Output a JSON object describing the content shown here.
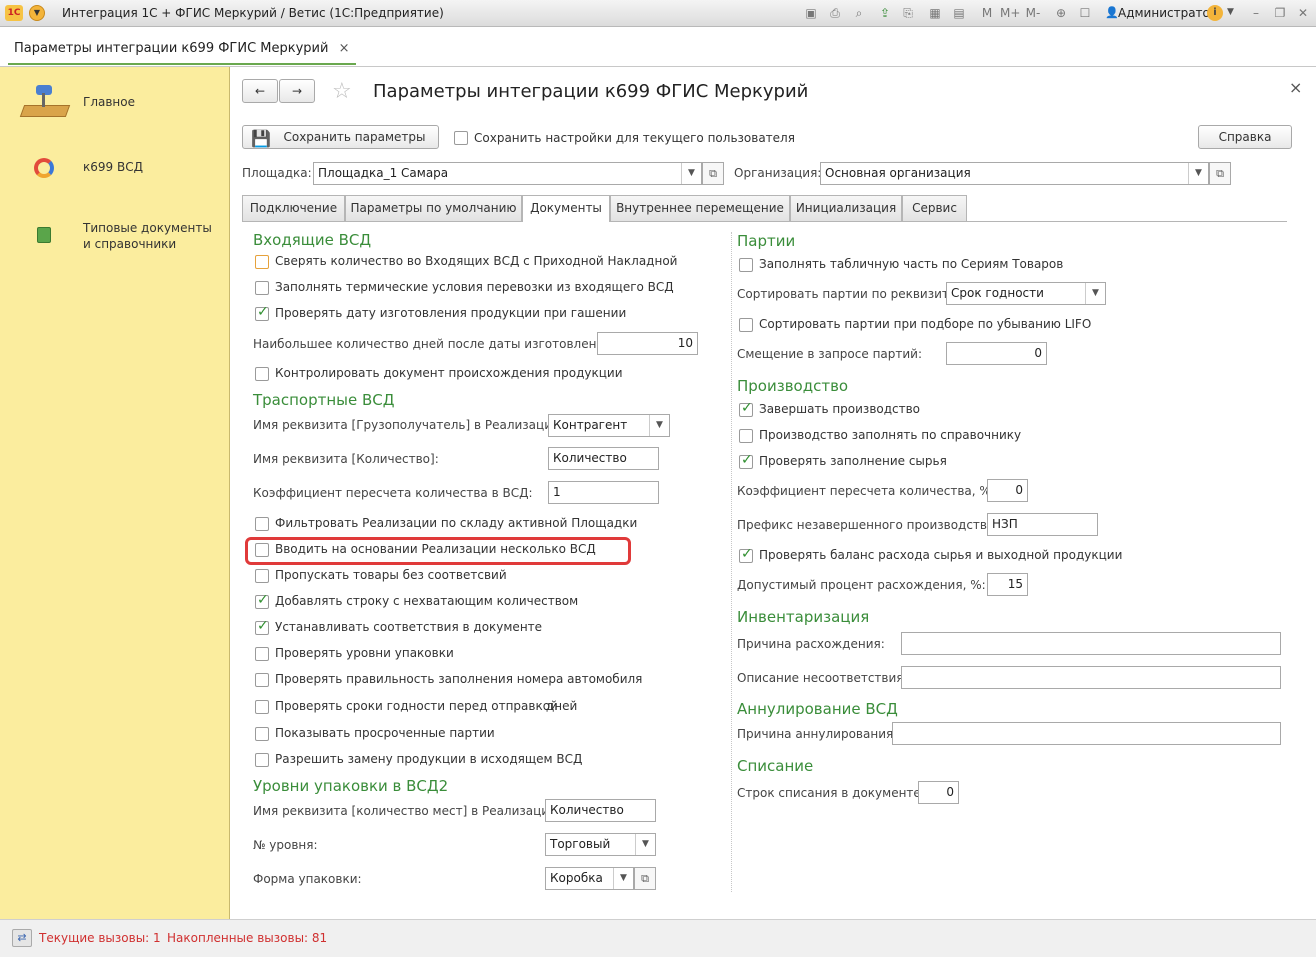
{
  "titlebar": {
    "title": "Интеграция 1С + ФГИС Меркурий / Ветис  (1С:Предприятие)",
    "user": "Администратор",
    "memory_buttons": [
      "M",
      "M+",
      "M-"
    ]
  },
  "doc_tab": {
    "label": "Параметры интеграции к699 ФГИС Меркурий",
    "close": "×"
  },
  "sidebar": {
    "items": [
      {
        "label": "Главное",
        "icon": "desk-lamp-icon"
      },
      {
        "label": "к699 ВСД",
        "icon": "mercury-logo-icon"
      },
      {
        "label": "Типовые документы и справочники",
        "icon": "book-icon"
      }
    ]
  },
  "form": {
    "title": "Параметры интеграции к699 ФГИС Меркурий",
    "close": "×",
    "save_button": "Сохранить параметры",
    "save_user_settings": "Сохранить настройки для текущего пользователя",
    "help_button": "Справка",
    "site_label": "Площадка:",
    "site_value": "Площадка_1 Самара",
    "org_label": "Организация:",
    "org_value": "Основная организация"
  },
  "tabs": [
    {
      "label": "Подключение",
      "active": false
    },
    {
      "label": "Параметры по умолчанию",
      "active": false
    },
    {
      "label": "Документы",
      "active": true
    },
    {
      "label": "Внутреннее перемещение",
      "active": false
    },
    {
      "label": "Инициализация",
      "active": false
    },
    {
      "label": "Сервис",
      "active": false
    }
  ],
  "incoming": {
    "heading": "Входящие ВСД",
    "cb1": {
      "label": "Сверять количество во Входящих ВСД с Приходной Накладной",
      "checked": false
    },
    "cb2": {
      "label": "Заполнять термические условия перевозки из входящего ВСД",
      "checked": false
    },
    "cb3": {
      "label": "Проверять дату изготовления продукции при гашении",
      "checked": true
    },
    "max_days_label": "Наибольшее количество дней после даты изготовления:",
    "max_days_value": "10",
    "cb4": {
      "label": "Контролировать документ происхождения продукции",
      "checked": false
    }
  },
  "transport": {
    "heading": "Траспортные ВСД",
    "consignee_label": "Имя реквизита [Грузополучатель] в Реализации:",
    "consignee_value": "Контрагент",
    "qty_label": "Имя реквизита [Количество]:",
    "qty_value": "Количество",
    "coef_label": "Коэффициент пересчета количества в ВСД:",
    "coef_value": "1",
    "cb1": {
      "label": "Фильтровать Реализации по складу активной Площадки",
      "checked": false
    },
    "cb2": {
      "label": "Вводить на основании Реализации несколько ВСД",
      "checked": false
    },
    "cb3": {
      "label": "Пропускать товары без соответсвий",
      "checked": false
    },
    "cb4": {
      "label": "Добавлять строку с нехватающим количеством",
      "checked": true
    },
    "cb5": {
      "label": "Устанавливать соответствия в документе",
      "checked": true
    },
    "cb6": {
      "label": "Проверять уровни упаковки",
      "checked": false
    },
    "cb7": {
      "label": "Проверять правильность заполнения номера автомобиля",
      "checked": false
    },
    "cb8": {
      "label": "Проверять сроки годности перед отправкой",
      "checked": false,
      "suffix": "дней"
    },
    "cb9": {
      "label": "Показывать просроченные партии",
      "checked": false
    },
    "cb10": {
      "label": "Разрешить замену продукции в исходящем ВСД",
      "checked": false
    }
  },
  "packaging": {
    "heading": "Уровни упаковки в ВСД2",
    "places_label": "Имя реквизита [количество мест] в Реализации:",
    "places_value": "Количество",
    "level_label": "№ уровня:",
    "level_value": "Торговый",
    "form_label": "Форма упаковки:",
    "form_value": "Коробка"
  },
  "batches": {
    "heading": "Партии",
    "cb1": {
      "label": "Заполнять табличную часть по Сериям Товаров",
      "checked": false
    },
    "sort_label": "Сортировать партии по реквизиту:",
    "sort_value": "Срок годности",
    "cb2": {
      "label": "Сортировать партии при подборе по убыванию LIFO",
      "checked": false
    },
    "offset_label": "Смещение в запросе партий:",
    "offset_value": "0"
  },
  "production": {
    "heading": "Производство",
    "cb1": {
      "label": "Завершать производство",
      "checked": true
    },
    "cb2": {
      "label": "Производство заполнять по справочнику",
      "checked": false
    },
    "cb3": {
      "label": "Проверять заполнение сырья",
      "checked": true
    },
    "coef_label": "Коэффициент пересчета количества, %:",
    "coef_value": "0",
    "prefix_label": "Префикс незавершенного производства:",
    "prefix_value": "НЗП",
    "cb4": {
      "label": "Проверять баланс расхода сырья и выходной продукции",
      "checked": true
    },
    "percent_label": "Допустимый процент расхождения, %:",
    "percent_value": "15"
  },
  "inventory": {
    "heading": "Инвентаризация",
    "reason_label": "Причина расхождения:",
    "reason_value": "",
    "desc_label": "Описание несоответствия:",
    "desc_value": ""
  },
  "cancel": {
    "heading": "Аннулирование ВСД",
    "reason_label": "Причина аннулирования:",
    "reason_value": ""
  },
  "writeoff": {
    "heading": "Списание",
    "rows_label": "Строк списания в документе:",
    "rows_value": "0"
  },
  "statusbar": {
    "current_calls": "Текущие вызовы: 1",
    "total_calls": "Накопленные вызовы: 81"
  },
  "colors": {
    "accent_green": "#3a8d3a",
    "sidebar": "#fbed9e",
    "highlight": "#e03a3a",
    "status_red": "#d03030"
  }
}
